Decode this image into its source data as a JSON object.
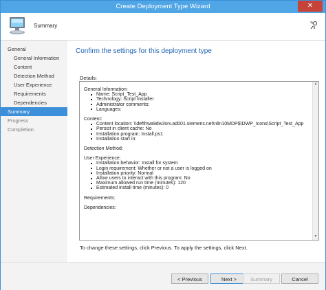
{
  "window": {
    "title": "Create Deployment Type Wizard",
    "close_glyph": "✕"
  },
  "banner": {
    "title": "Summary",
    "icon": "computer-monitor-icon",
    "help_icon": "help-person-icon"
  },
  "sidebar": {
    "items": [
      {
        "label": "General",
        "level": 0,
        "selected": false,
        "muted": false
      },
      {
        "label": "General Information",
        "level": 1,
        "selected": false,
        "muted": false
      },
      {
        "label": "Content",
        "level": 1,
        "selected": false,
        "muted": false
      },
      {
        "label": "Detection Method",
        "level": 1,
        "selected": false,
        "muted": false
      },
      {
        "label": "User Experience",
        "level": 1,
        "selected": false,
        "muted": false
      },
      {
        "label": "Requirements",
        "level": 1,
        "selected": false,
        "muted": false
      },
      {
        "label": "Dependencies",
        "level": 1,
        "selected": false,
        "muted": false
      },
      {
        "label": "Summary",
        "level": 0,
        "selected": true,
        "muted": false
      },
      {
        "label": "Progress",
        "level": 0,
        "selected": false,
        "muted": true
      },
      {
        "label": "Completion",
        "level": 0,
        "selected": false,
        "muted": true
      }
    ]
  },
  "main": {
    "heading": "Confirm the settings for this deployment type",
    "details_label": "Details:",
    "sections": [
      {
        "title": "General Information:",
        "items": [
          "Name: Script_Test_App",
          "Technology: Script Installer",
          "Administrator comments:",
          "Languages:"
        ]
      },
      {
        "title": "Content:",
        "items": [
          "Content location: \\\\defthwa9dw3srv.ad001.siemens.net\\nlin10MDP$\\DWP_Icons\\Script_Test_App",
          "Persist in client cache: No",
          "Installation program: Install.ps1",
          "Installation start in:"
        ]
      },
      {
        "title": "Detection Method:",
        "items": []
      },
      {
        "title": "User Experience:",
        "items": [
          "Installation behavior: Install for system",
          "Login requirement: Whether or not a user is logged on",
          "Installation priority: Normal",
          "Allow users to interact with this program: No",
          "Maximum allowed run time (minutes): 120",
          "Estimated install time (minutes): 0"
        ]
      },
      {
        "title": "Requirements:",
        "items": []
      },
      {
        "title": "Dependencies:",
        "items": []
      }
    ],
    "instruction": "To change these settings, click Previous. To apply the settings, click Next."
  },
  "footer": {
    "previous_label": "< Previous",
    "next_label": "Next >",
    "summary_label": "Summary",
    "cancel_label": "Cancel"
  },
  "colors": {
    "title_bar": "#4fa5e5",
    "heading": "#1f63b4",
    "selected_nav": "#3c8fd8"
  }
}
